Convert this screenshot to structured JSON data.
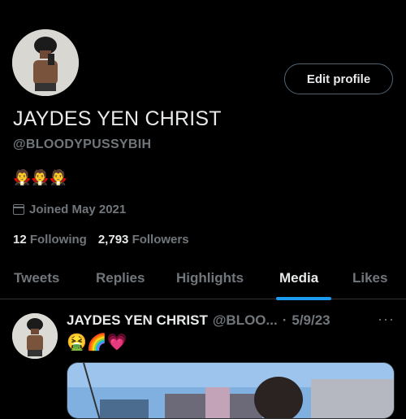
{
  "profile": {
    "edit_button": "Edit profile",
    "display_name": "JAYDES YEN CHRIST",
    "handle": "@BLOODYPUSSYBIH",
    "bio_emojis": "🧛🧛🧛",
    "joined": "Joined May 2021",
    "following_count": "12",
    "following_label": "Following",
    "followers_count": "2,793",
    "followers_label": "Followers"
  },
  "tabs": [
    {
      "label": "Tweets"
    },
    {
      "label": "Replies"
    },
    {
      "label": "Highlights"
    },
    {
      "label": "Media",
      "active": true
    },
    {
      "label": "Likes"
    }
  ],
  "tweet": {
    "name": "JAYDES YEN CHRIST",
    "handle": "@BLOO...",
    "separator": "·",
    "date": "5/9/23",
    "more": "···",
    "text": "🤮🌈💗"
  },
  "colors": {
    "accent": "#1d9bf0",
    "muted": "#71767b",
    "text": "#e7e9ea",
    "background": "#000000"
  }
}
